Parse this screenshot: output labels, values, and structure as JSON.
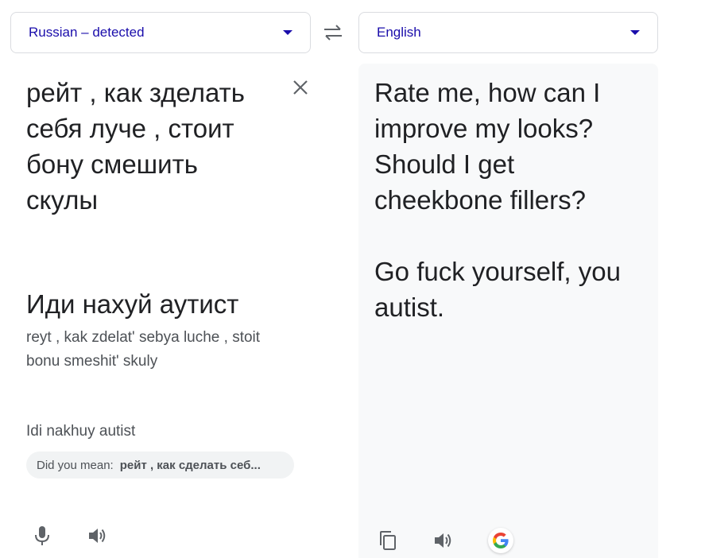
{
  "source_language": {
    "label": "Russian – detected"
  },
  "target_language": {
    "label": "English"
  },
  "source": {
    "text": "рейт , как зделать\nсебя луче , стоит\nбону смешить\nскулы",
    "text_2": "Иди нахуй аутист",
    "transliteration": "reyt , kak zdelat' sebya luche , stoit\nbonu smeshit' skuly",
    "transliteration_2": "Idi nakhuy autist",
    "did_you_mean": {
      "prefix": "Did you mean:",
      "suggestion": "рейт , как сделать себ..."
    }
  },
  "target": {
    "text": "Rate me, how can I\nimprove my looks?\nShould I get\ncheekbone fillers?\n\nGo fuck yourself, you\nautist."
  },
  "icons": {
    "swap": "swap-icon",
    "clear": "close-icon",
    "mic": "microphone-icon",
    "speaker": "speaker-icon",
    "copy": "copy-icon",
    "google": "google-logo"
  },
  "colors": {
    "link": "#1a0dab",
    "text": "#202124",
    "secondary_text": "#4d5156",
    "target_bg": "#f8f9fa",
    "border": "#dadce0"
  }
}
